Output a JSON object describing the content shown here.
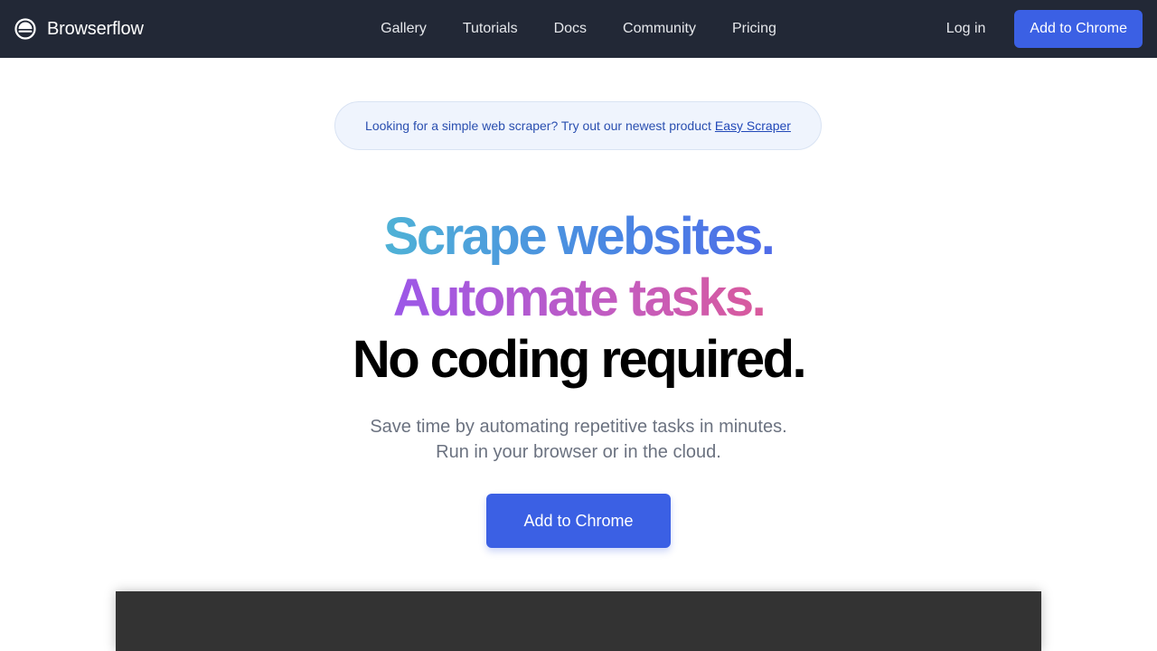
{
  "header": {
    "brand_name": "Browserflow",
    "nav": [
      {
        "label": "Gallery"
      },
      {
        "label": "Tutorials"
      },
      {
        "label": "Docs"
      },
      {
        "label": "Community"
      },
      {
        "label": "Pricing"
      }
    ],
    "login_label": "Log in",
    "cta_label": "Add to Chrome"
  },
  "announcement": {
    "text": "Looking for a simple web scraper? Try out our newest product",
    "link_label": "Easy Scraper"
  },
  "hero": {
    "line1": "Scrape websites.",
    "line2": "Automate tasks.",
    "line3": "No coding required."
  },
  "subtitle": {
    "line1": "Save time by automating repetitive tasks in minutes.",
    "line2": "Run in your browser or in the cloud."
  },
  "main_cta_label": "Add to Chrome",
  "colors": {
    "navbar_bg": "#222836",
    "accent": "#3b60e4",
    "announcement_bg": "#eff4fd",
    "video_bg": "#333333"
  },
  "icons": {
    "brand_logo": "browserflow-logo-icon"
  }
}
